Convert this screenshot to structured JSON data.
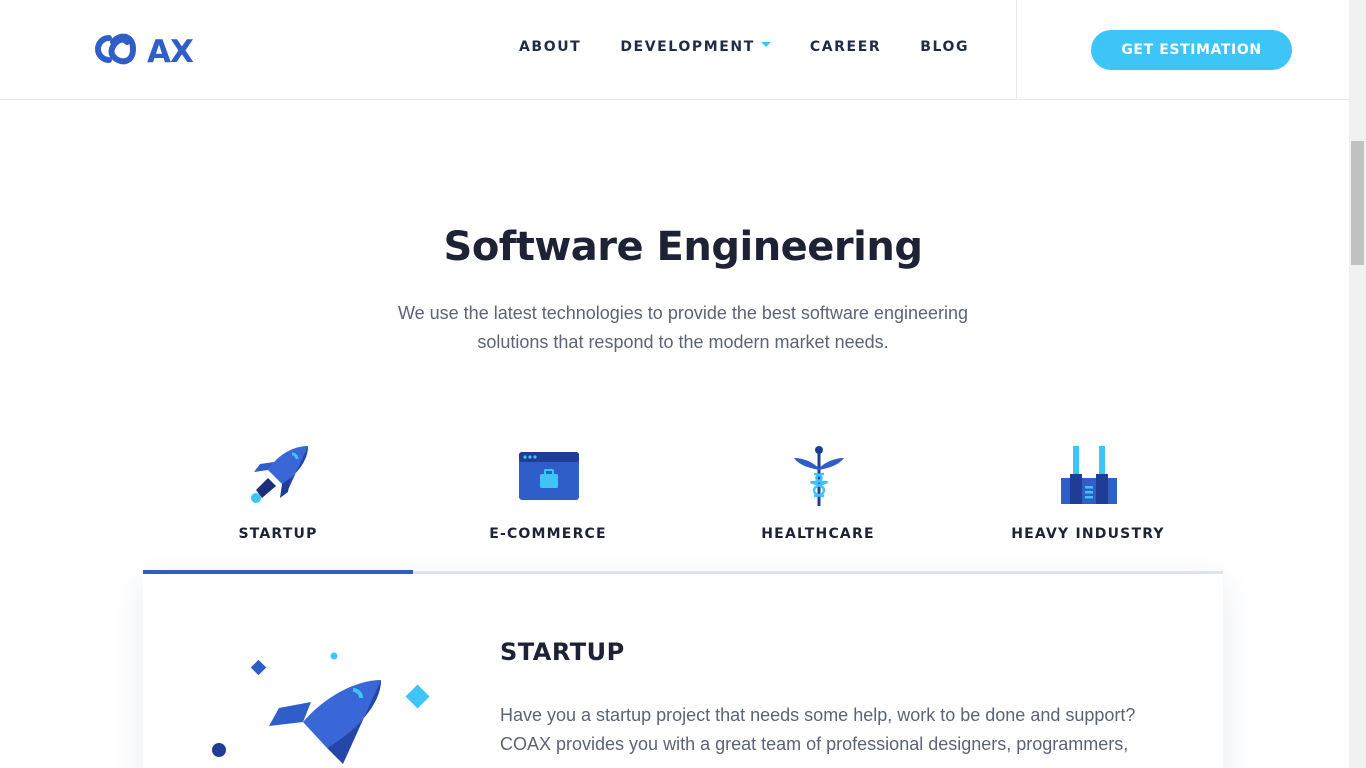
{
  "header": {
    "logo_text": "COAX",
    "nav": [
      {
        "label": "ABOUT",
        "has_dropdown": false
      },
      {
        "label": "DEVELOPMENT",
        "has_dropdown": true
      },
      {
        "label": "CAREER",
        "has_dropdown": false
      },
      {
        "label": "BLOG",
        "has_dropdown": false
      }
    ],
    "cta_label": "GET ESTIMATION"
  },
  "hero": {
    "title": "Software Engineering",
    "subtitle": "We use the latest technologies to provide the best software engineering solutions that respond to the modern market needs."
  },
  "tabs": [
    {
      "label": "STARTUP",
      "icon": "rocket-icon",
      "active": true
    },
    {
      "label": "E-COMMERCE",
      "icon": "shop-window-icon",
      "active": false
    },
    {
      "label": "HEALTHCARE",
      "icon": "caduceus-icon",
      "active": false
    },
    {
      "label": "HEAVY INDUSTRY",
      "icon": "factory-icon",
      "active": false
    }
  ],
  "panel": {
    "title": "STARTUP",
    "text": "Have you a startup project that needs some help, work to be done and support? COAX provides you with a great team of professional designers, programmers,"
  },
  "colors": {
    "brand_blue": "#2f5ec8",
    "accent_cyan": "#3ec5f8",
    "text_dark": "#1e2235",
    "text_muted": "#5c6474"
  }
}
